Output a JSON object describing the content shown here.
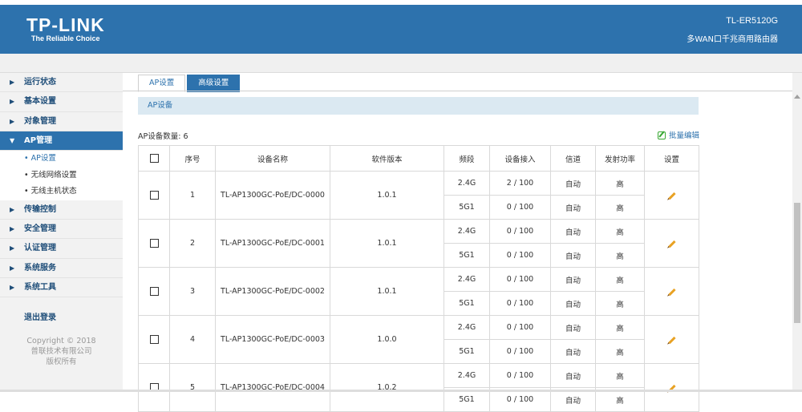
{
  "header": {
    "logo": "TP-LINK",
    "tagline": "The Reliable Choice",
    "model": "TL-ER5120G",
    "subtitle": "多WAN口千兆商用路由器"
  },
  "sidebar": {
    "items": [
      {
        "label": "运行状态"
      },
      {
        "label": "基本设置"
      },
      {
        "label": "对象管理"
      },
      {
        "label": "AP管理",
        "active": true,
        "subitems": [
          {
            "label": "AP设置"
          },
          {
            "label": "无线网络设置"
          },
          {
            "label": "无线主机状态"
          }
        ]
      },
      {
        "label": "传输控制"
      },
      {
        "label": "安全管理"
      },
      {
        "label": "认证管理"
      },
      {
        "label": "系统服务"
      },
      {
        "label": "系统工具"
      }
    ],
    "logout": "退出登录",
    "copyright": [
      "Copyright © 2018",
      "普联技术有限公司",
      "版权所有"
    ]
  },
  "tabs": [
    {
      "label": "AP设置"
    },
    {
      "label": "高级设置"
    }
  ],
  "section_title": "AP设备",
  "count_label": "AP设备数量: 6",
  "batch_edit": "批量编辑",
  "table": {
    "headers": [
      "序号",
      "设备名称",
      "软件版本",
      "频段",
      "设备接入",
      "信道",
      "发射功率",
      "设置"
    ],
    "rows": [
      {
        "index": "1",
        "name": "TL-AP1300GC-PoE/DC-0000",
        "version": "1.0.1",
        "bands": [
          {
            "band": "2.4G",
            "access": "2 / 100",
            "channel": "自动",
            "power": "高"
          },
          {
            "band": "5G1",
            "access": "0 / 100",
            "channel": "自动",
            "power": "高"
          }
        ]
      },
      {
        "index": "2",
        "name": "TL-AP1300GC-PoE/DC-0001",
        "version": "1.0.1",
        "bands": [
          {
            "band": "2.4G",
            "access": "0 / 100",
            "channel": "自动",
            "power": "高"
          },
          {
            "band": "5G1",
            "access": "0 / 100",
            "channel": "自动",
            "power": "高"
          }
        ]
      },
      {
        "index": "3",
        "name": "TL-AP1300GC-PoE/DC-0002",
        "version": "1.0.1",
        "bands": [
          {
            "band": "2.4G",
            "access": "0 / 100",
            "channel": "自动",
            "power": "高"
          },
          {
            "band": "5G1",
            "access": "0 / 100",
            "channel": "自动",
            "power": "高"
          }
        ]
      },
      {
        "index": "4",
        "name": "TL-AP1300GC-PoE/DC-0003",
        "version": "1.0.0",
        "bands": [
          {
            "band": "2.4G",
            "access": "0 / 100",
            "channel": "自动",
            "power": "高"
          },
          {
            "band": "5G1",
            "access": "0 / 100",
            "channel": "自动",
            "power": "高"
          }
        ]
      },
      {
        "index": "5",
        "name": "TL-AP1300GC-PoE/DC-0004",
        "version": "1.0.2",
        "bands": [
          {
            "band": "2.4G",
            "access": "0 / 100",
            "channel": "自动",
            "power": "高"
          },
          {
            "band": "5G1",
            "access": "0 / 100",
            "channel": "自动",
            "power": "高"
          }
        ]
      }
    ]
  },
  "colors": {
    "brand": "#2d72ad",
    "accent_green": "#3aa935",
    "edit_icon": "#e8a224"
  }
}
